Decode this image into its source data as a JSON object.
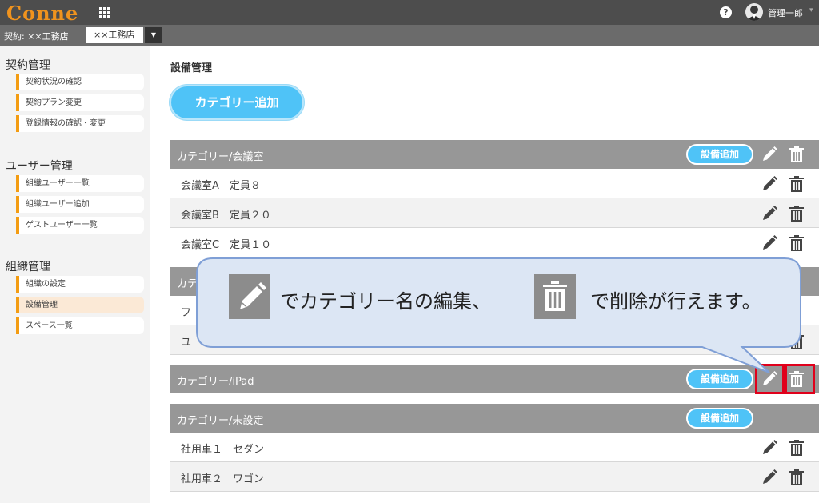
{
  "app": {
    "logo": "Conne"
  },
  "header": {
    "help_glyph": "?",
    "user_name": "管理一郎"
  },
  "contract": {
    "label": "契約: ××工務店",
    "selected": "××工務店"
  },
  "sidebar": {
    "groups": [
      {
        "title": "契約管理",
        "items": [
          "契約状況の確認",
          "契約プラン変更",
          "登録情報の確認・変更"
        ]
      },
      {
        "title": "ユーザー管理",
        "items": [
          "組織ユーザー一覧",
          "組織ユーザー追加",
          "ゲストユーザー一覧"
        ]
      },
      {
        "title": "組織管理",
        "items": [
          "組織の設定",
          "設備管理",
          "スペース一覧"
        ]
      }
    ]
  },
  "main": {
    "title": "設備管理",
    "add_category_label": "カテゴリー追加",
    "add_equipment_label": "設備追加",
    "categories": [
      {
        "title": "カテゴリー/会議室",
        "rows": [
          "会議室A　定員８",
          "会議室B　定員２０",
          "会議室C　定員１０"
        ]
      },
      {
        "title": "カテ",
        "rows": [
          "フ",
          "ユ"
        ]
      },
      {
        "title": "カテゴリー/iPad",
        "rows": []
      },
      {
        "title": "カテゴリー/未設定",
        "rows": [
          "社用車１　セダン",
          "社用車２　ワゴン"
        ]
      }
    ]
  },
  "callout": {
    "part1": "でカテゴリー名の編集、",
    "part2": "で削除が行えます。"
  },
  "colors": {
    "accent": "#f39c12",
    "button": "#4fc3f7",
    "highlight": "#e0001b"
  }
}
